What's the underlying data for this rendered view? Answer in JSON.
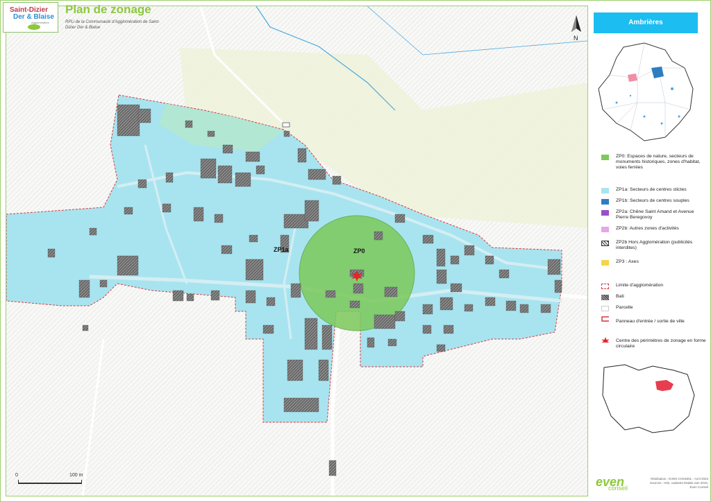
{
  "logo": {
    "line1": "Saint-Dizier",
    "line2": "Der & Blaise",
    "line3": "Agglomération"
  },
  "title": "Plan de zonage",
  "subtitle": "RPLi de la Communauté d'Agglomération de Saint-Dizier Der & Blaise",
  "commune": "Ambrières",
  "north": "N",
  "map_labels": {
    "zp1a": "ZP1a",
    "zp0": "ZP0"
  },
  "legend": [
    {
      "label": "ZP0: Espaces de nature, secteurs de monuments historiques, zones d'habitat, voies ferrées",
      "color": "#7cc95a",
      "kind": "fill"
    },
    {
      "label": "ZP1a: Secteurs de centres stictes",
      "color": "#a8e4ef",
      "kind": "fill"
    },
    {
      "label": "ZP1b: Secteurs de centres souples",
      "color": "#2f7dc1",
      "kind": "fill"
    },
    {
      "label": "ZP2a: Chêne Saint Amand et Avenue Pierre Beregovoy",
      "color": "#9a4fc6",
      "kind": "fill"
    },
    {
      "label": "ZP2b: Autres zones d'activités",
      "color": "#e6a6ea",
      "kind": "fill"
    },
    {
      "label": "ZP2b Hors Agglomération (publicités interdites)",
      "color": "#333333",
      "kind": "hatch"
    },
    {
      "label": "ZP3 : Axes",
      "color": "#f5d44a",
      "kind": "fill"
    },
    {
      "label": "Limite d'agglomération",
      "color": "#d9363e",
      "kind": "dashed"
    },
    {
      "label": "Bati",
      "color": "#555555",
      "kind": "hatch-fill"
    },
    {
      "label": "Parcelle",
      "color": "#cccccc",
      "kind": "outline"
    },
    {
      "label": "Panneau d'entrée / sortie de ville",
      "color": "#d9363e",
      "kind": "sign"
    },
    {
      "label": "Centre des périmètres de zonage en forme circulaire",
      "color": "#e2262b",
      "kind": "star"
    }
  ],
  "scale": {
    "start": "0",
    "end": "100 m"
  },
  "brand": {
    "name": "even",
    "sub": "conseil"
  },
  "credits": [
    "Réalisation : EVEN CONSEIL - Avril 2023",
    "Sources : IGN, cadastre Etalab Juin 2019,",
    "Even Conseil"
  ]
}
